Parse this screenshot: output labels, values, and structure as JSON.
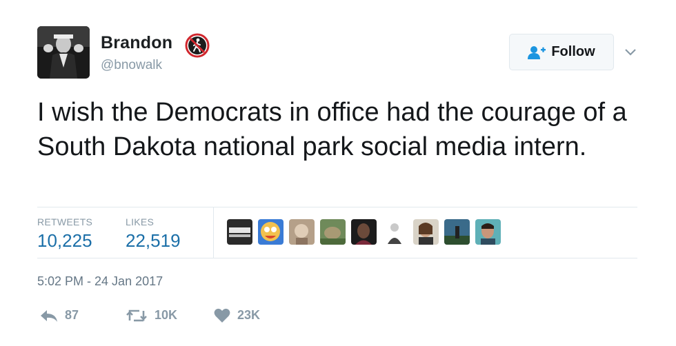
{
  "author": {
    "name": "Brandon",
    "handle": "@bnowalk",
    "avatar_icon": "avatar-photo",
    "badge_icon": "no-walking-icon"
  },
  "follow_button": {
    "label": "Follow",
    "icon": "add-person-icon"
  },
  "tweet": {
    "text": "I wish the Democrats in office had the courage of a South Dakota national park social media intern."
  },
  "stats": {
    "retweets_label": "RETWEETS",
    "retweets_value": "10,225",
    "likes_label": "LIKES",
    "likes_value": "22,519"
  },
  "timestamp": "5:02 PM - 24 Jan 2017",
  "actions": {
    "reply_count": "87",
    "retweet_count": "10K",
    "like_count": "23K"
  },
  "colors": {
    "link_blue": "#1b6fa8",
    "muted_gray": "#8899a6",
    "text_dark": "#14171a",
    "divider": "#e1e8ed",
    "badge_red": "#d0262d"
  }
}
